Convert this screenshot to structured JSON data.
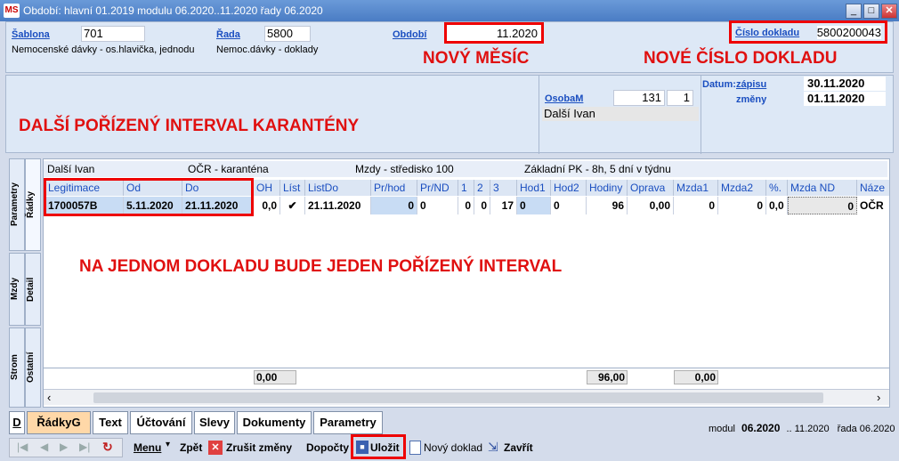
{
  "window": {
    "title": "Období: hlavní 01.2019 modulu 06.2020..11.2020 řady 06.2020",
    "logo": "MS"
  },
  "header": {
    "sablona_label": "Šablona",
    "sablona_value": "701",
    "sablona_desc": "Nemocenské dávky - os.hlavička, jednodu",
    "rada_label": "Řada",
    "rada_value": "5800",
    "rada_desc": "Nemoc.dávky - doklady",
    "obdobi_label": "Období",
    "obdobi_value": "11.2020",
    "cislo_label": "Číslo dokladu",
    "cislo_value": "5800200043"
  },
  "annotations": {
    "novy_mesic": "NOVÝ MĚSÍC",
    "nove_cislo": "NOVÉ ČÍSLO DOKLADU",
    "dalsi_interval": "DALŠÍ POŘÍZENÝ INTERVAL KARANTÉNY",
    "jeden_interval": "NA JEDNOM DOKLADU BUDE JEDEN POŘÍZENÝ INTERVAL"
  },
  "person": {
    "osoba_label": "OsobaM",
    "osoba_id": "131",
    "osoba_n": "1",
    "name": "Další Ivan",
    "datum_label": "Datum:",
    "zapisu_label": "zápisu",
    "zapisu_value": "30.11.2020",
    "zmeny_label": "změny",
    "zmeny_value": "01.11.2020"
  },
  "sidetabs": {
    "parametry": "Parametry",
    "radky": "Řádky",
    "mzdy": "Mzdy",
    "detail": "Detail",
    "strom": "Strom",
    "ostatni": "Ostatní"
  },
  "inforow": {
    "name": "Další Ivan",
    "type": "OČR - karanténa",
    "stredisko": "Mzdy - středisko 100",
    "pk": "Základní PK - 8h, 5 dní v týdnu"
  },
  "table": {
    "columns": [
      "Legitimace",
      "Od",
      "Do",
      "OH",
      "Líst",
      "ListDo",
      "Pr/hod",
      "Pr/ND",
      "1",
      "2",
      "3",
      "Hod1",
      "Hod2",
      "Hodiny",
      "Oprava",
      "Mzda1",
      "Mzda2",
      "%.",
      "Mzda ND",
      "Náze"
    ],
    "row": [
      "1700057B",
      "5.11.2020",
      "21.11.2020",
      "0,0",
      "✔",
      "21.11.2020",
      "0",
      "0",
      "0",
      "0",
      "17",
      "0",
      "0",
      "96",
      "0,00",
      "0",
      "0",
      "0,0",
      "0",
      "OČR"
    ],
    "footer_oh": "0,00",
    "footer_hodiny": "96,00",
    "footer_oprava": "0,00"
  },
  "tabs": {
    "d": "D",
    "radky": "ŘádkyG",
    "text": "Text",
    "uctovani": "Účtování",
    "slevy": "Slevy",
    "dokumenty": "Dokumenty",
    "parametry": "Parametry"
  },
  "status": {
    "modul_label": "modul",
    "modul_value": "06.2020",
    "range": ".. 11.2020",
    "rada": "řada 06.2020"
  },
  "toolbar": {
    "menu": "Menu",
    "zpet": "Zpět",
    "zrusit": "Zrušit změny",
    "dopocty": "Dopočty",
    "ulozit": "Uložit",
    "novy": "Nový doklad",
    "zavrit": "Zavřít"
  },
  "colors": {
    "accent": "#1a4ec0",
    "annotation": "#e01010",
    "selected_row": "#c8dcf4"
  }
}
